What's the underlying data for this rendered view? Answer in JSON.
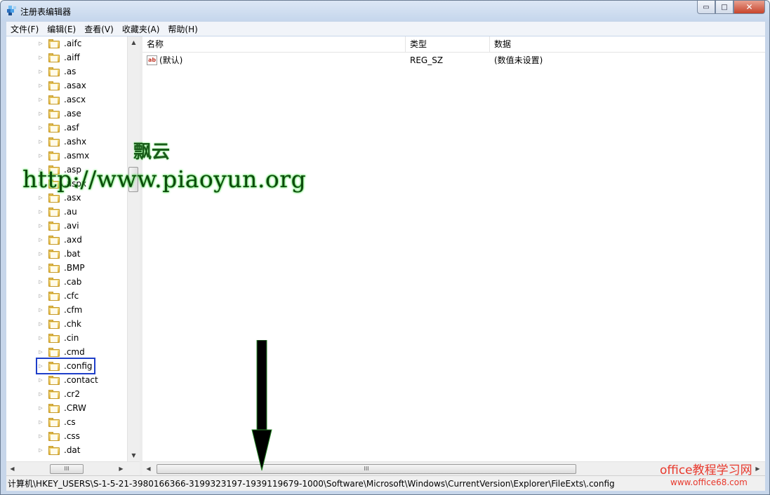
{
  "window": {
    "title": "注册表编辑器",
    "caption": {
      "minimize": "▭",
      "maximize": "□",
      "close": "✕"
    }
  },
  "menu": [
    "文件(F)",
    "编辑(E)",
    "查看(V)",
    "收藏夹(A)",
    "帮助(H)"
  ],
  "tree": {
    "items": [
      ".aifc",
      ".aiff",
      ".as",
      ".asax",
      ".ascx",
      ".ase",
      ".asf",
      ".ashx",
      ".asmx",
      ".asp",
      ".aspx",
      ".asx",
      ".au",
      ".avi",
      ".axd",
      ".bat",
      ".BMP",
      ".cab",
      ".cfc",
      ".cfm",
      ".chk",
      ".cin",
      ".cmd",
      ".config",
      ".contact",
      ".cr2",
      ".CRW",
      ".cs",
      ".css",
      ".dat"
    ],
    "selected": ".config"
  },
  "list": {
    "columns": [
      "名称",
      "类型",
      "数据"
    ],
    "rows": [
      {
        "icon": "ab",
        "name": "(默认)",
        "type": "REG_SZ",
        "data": "(数值未设置)"
      }
    ]
  },
  "scroll": {
    "grip": "III",
    "up": "▲",
    "down": "▼",
    "left": "◀",
    "right": "▶"
  },
  "status": "计算机\\HKEY_USERS\\S-1-5-21-3980166366-3199323197-1939119679-1000\\Software\\Microsoft\\Windows\\CurrentVersion\\Explorer\\FileExts\\.config",
  "watermarks": {
    "cn": "飘云",
    "url": "http://www.piaoyun.org",
    "office": "office教程学习网",
    "office_url": "www.office68.com"
  },
  "colors": {
    "selection_border": "#1f3fc9",
    "watermark_green": "#0d4a0d",
    "watermark_red": "#e8382c"
  }
}
